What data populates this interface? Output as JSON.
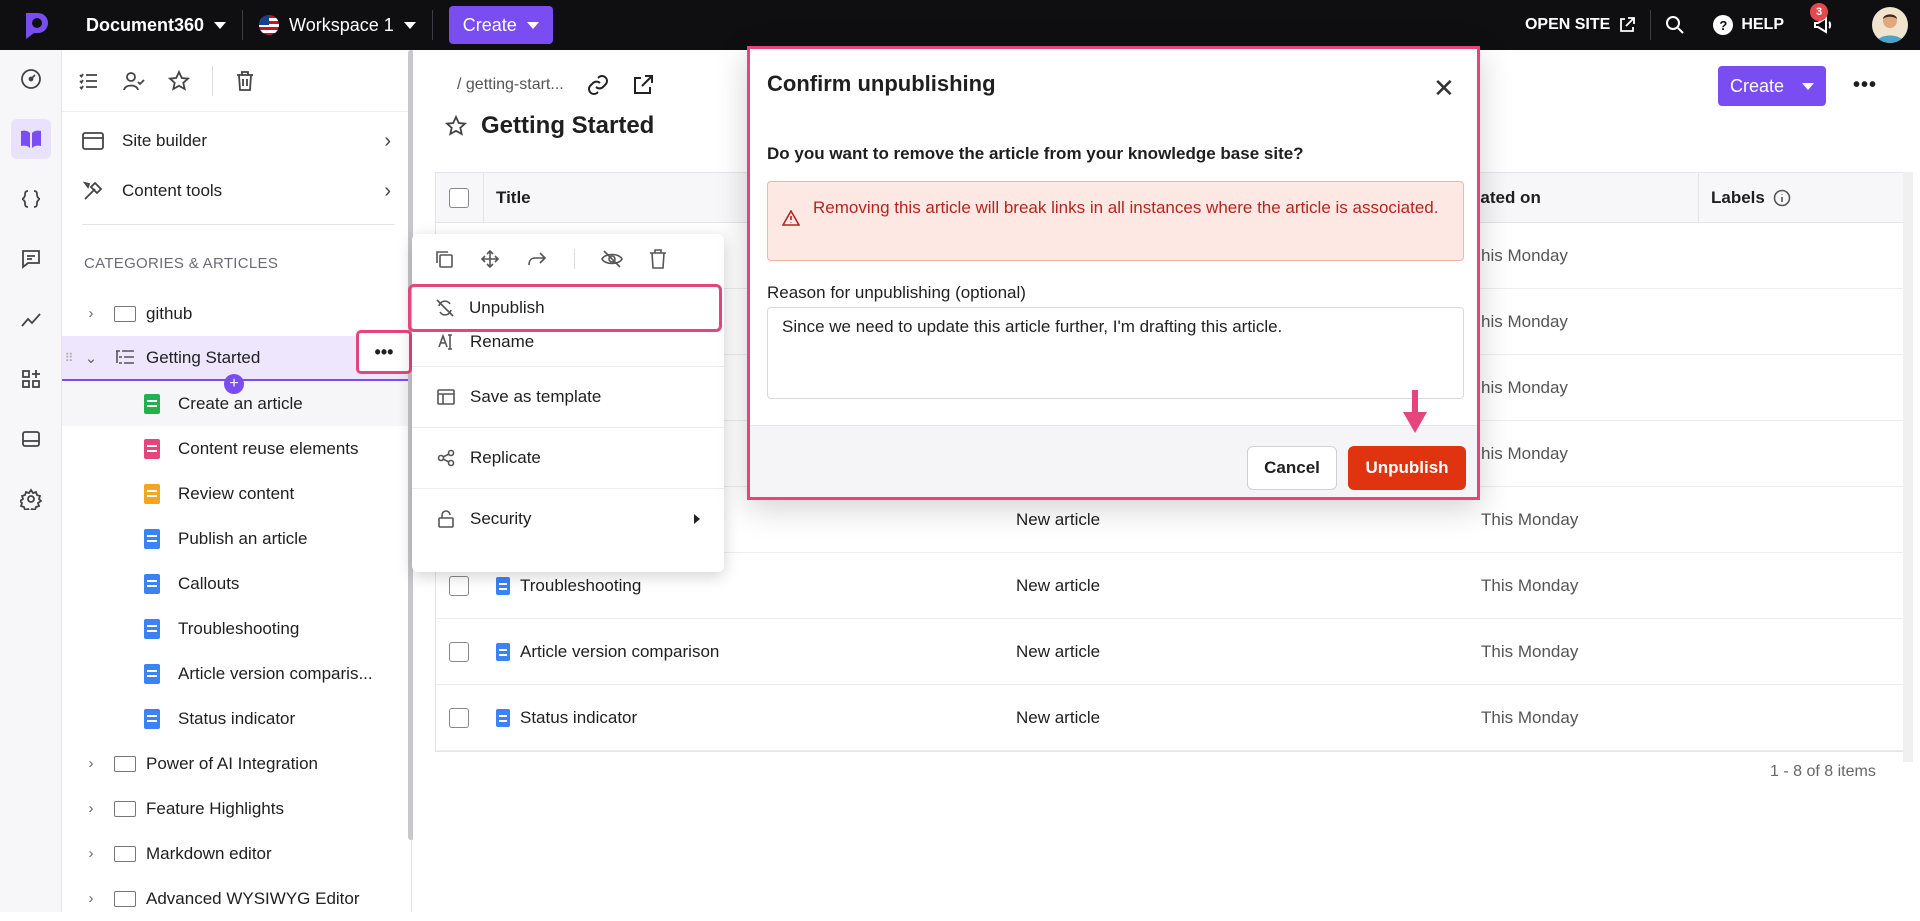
{
  "topbar": {
    "project_name": "Document360",
    "workspace": "Workspace 1",
    "create_label": "Create",
    "open_site_label": "OPEN SITE",
    "help_label": "HELP",
    "notification_count": "3"
  },
  "rail": {
    "icons": [
      "dashboard-icon",
      "docs-icon",
      "api-icon",
      "feedback-icon",
      "analytics-icon",
      "extensions-icon",
      "widget-icon",
      "settings-icon"
    ]
  },
  "sidebar": {
    "site_builder": "Site builder",
    "content_tools": "Content tools",
    "section_title": "CATEGORIES & ARTICLES",
    "tree": [
      {
        "label": "github",
        "type": "folder"
      },
      {
        "label": "Getting Started",
        "type": "category"
      },
      {
        "label": "Create an article",
        "type": "article",
        "color": "#22b14c"
      },
      {
        "label": "Content reuse elements",
        "type": "article",
        "color": "#e6457b"
      },
      {
        "label": "Review content",
        "type": "article",
        "color": "#f5a524"
      },
      {
        "label": "Publish an article",
        "type": "article",
        "color": "#3b82f6"
      },
      {
        "label": "Callouts",
        "type": "article",
        "color": "#3b82f6"
      },
      {
        "label": "Troubleshooting",
        "type": "article",
        "color": "#3b82f6"
      },
      {
        "label": "Article version comparis...",
        "type": "article",
        "color": "#3b82f6"
      },
      {
        "label": "Status indicator",
        "type": "article",
        "color": "#3b82f6"
      },
      {
        "label": "Power of AI Integration",
        "type": "folder"
      },
      {
        "label": "Feature Highlights",
        "type": "folder"
      },
      {
        "label": "Markdown editor",
        "type": "folder"
      },
      {
        "label": "Advanced WYSIWYG Editor",
        "type": "folder"
      }
    ]
  },
  "context_menu": {
    "items": [
      "Unpublish",
      "Rename",
      "Save as template",
      "Replicate",
      "Security"
    ]
  },
  "main": {
    "breadcrumb": "/ getting-start...",
    "title": "Getting Started",
    "create_label": "Create",
    "columns": {
      "title": "Title",
      "updated": "dated on",
      "labels": "Labels"
    },
    "rows": [
      {
        "title": "",
        "status": "",
        "updated": "his Monday"
      },
      {
        "title": "",
        "status": "",
        "updated": "his Monday"
      },
      {
        "title": "",
        "status": "",
        "updated": "his Monday"
      },
      {
        "title": "",
        "status": "",
        "updated": "his Monday"
      },
      {
        "title": "",
        "status": "New article",
        "updated": "This Monday"
      },
      {
        "title": "Troubleshooting",
        "status": "New article",
        "updated": "This Monday"
      },
      {
        "title": "Article version comparison",
        "status": "New article",
        "updated": "This Monday"
      },
      {
        "title": "Status indicator",
        "status": "New article",
        "updated": "This Monday"
      }
    ],
    "pager": "1 - 8 of 8 items"
  },
  "modal": {
    "title": "Confirm unpublishing",
    "question": "Do you want to remove the article from your knowledge base site?",
    "warning": "Removing this article will break links in all instances where the article is associated.",
    "reason_label": "Reason for unpublishing (optional)",
    "reason_value": "Since we need to update this article further, I'm drafting this article.",
    "cancel_label": "Cancel",
    "unpublish_label": "Unpublish"
  },
  "colors": {
    "brand": "#7a4df2",
    "danger": "#e0330f",
    "highlight": "#e6457b"
  }
}
